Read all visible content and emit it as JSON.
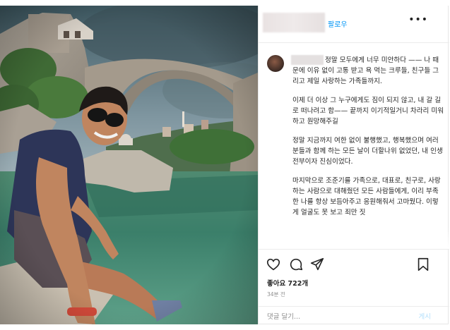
{
  "header": {
    "follow_label": "팔로우",
    "more_label": "•••"
  },
  "caption": {
    "paragraphs": [
      "정말 모두에게 너무 미안하다 —— 나 때문에 이유 없이 고통 받고 욕 먹는 크루들, 친구들 그리고 제일 사랑하는 가족들까지.",
      "이제 더 이상 그 누구에게도 짐이 되지 않고, 내 갈 길로 떠나려고 함—— 끝까지 이기적일거니 차라리 미워하고 원망해주길",
      "정말 지금까지 여한 없이 불행했고, 행복했으며 여러분들과 함께 하는 모든 날이 더할나위 없었던, 내 인생 전부이자 진심이었다.",
      "마지막으로 조준기를 가족으로, 대표로, 친구로, 사랑하는 사람으로 대해줬던 모든 사람들에게, 이리 부족한 나를 항상 보듬아주고 응원해줘서 고마웠다. 이렇게 얼굴도 못 보고 죄만 짓"
    ]
  },
  "actions": {
    "likes_text": "좋아요 722개",
    "time_text": "34분 전"
  },
  "comment": {
    "placeholder": "댓글 달기...",
    "post_label": "게시"
  },
  "colors": {
    "accent": "#0095f6",
    "post_disabled": "#b2dffc"
  },
  "icons": [
    "heart-icon",
    "comment-icon",
    "share-icon",
    "bookmark-icon",
    "more-icon"
  ]
}
